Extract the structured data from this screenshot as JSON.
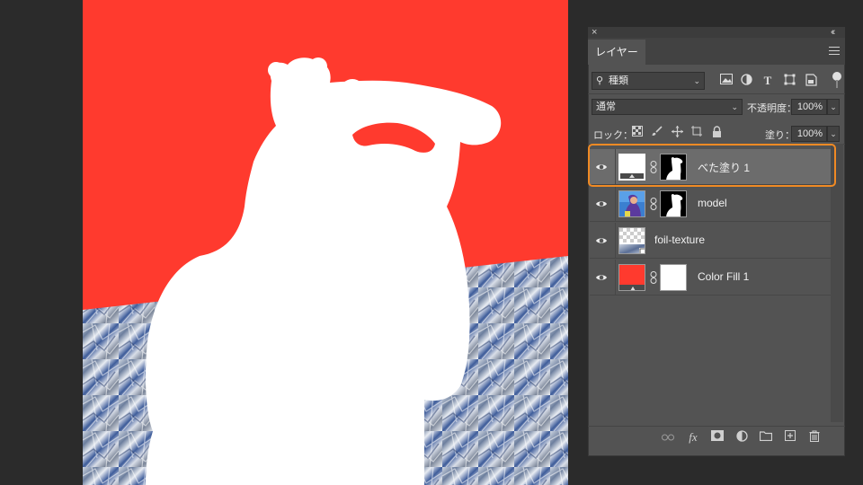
{
  "panel": {
    "close_glyph": "×",
    "collapse_glyph": "‹‹",
    "tab_label": "レイヤー"
  },
  "filter": {
    "kind_label": "種類",
    "icons": [
      "image-filter-icon",
      "adjustment-filter-icon",
      "type-filter-icon",
      "shape-filter-icon",
      "smart-object-filter-icon"
    ]
  },
  "blend": {
    "mode": "通常",
    "opacity_label": "不透明度：",
    "opacity_value": "100%"
  },
  "lock": {
    "label": "ロック：",
    "fill_label": "塗り：",
    "fill_value": "100%"
  },
  "layers": [
    {
      "name": "べた塗り 1",
      "selected": true,
      "visible": true
    },
    {
      "name": "model",
      "selected": false,
      "visible": true
    },
    {
      "name": "foil-texture",
      "selected": false,
      "visible": true
    },
    {
      "name": "Color Fill 1",
      "selected": false,
      "visible": true
    }
  ],
  "colors": {
    "canvas_red": "#ff3a2e",
    "highlight_orange": "#f08a24",
    "panel_bg": "#535353"
  },
  "bottom_icons": [
    "link-layers-icon",
    "fx-icon",
    "add-mask-icon",
    "adjustment-layer-icon",
    "new-group-icon",
    "new-layer-icon",
    "trash-icon"
  ]
}
